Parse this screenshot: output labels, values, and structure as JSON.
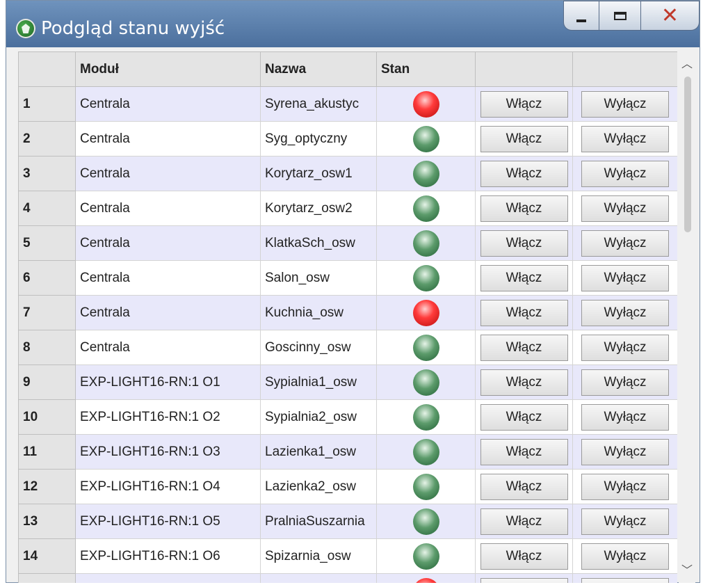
{
  "window": {
    "title": "Podgląd stanu wyjść",
    "colors": {
      "titlebar": "#5a7fae",
      "led_on": "#ff3b3b",
      "led_off": "#3f8452",
      "row_alt": "#e8e8fa"
    }
  },
  "table": {
    "columns": [
      "",
      "Moduł",
      "Nazwa",
      "Stan",
      "",
      ""
    ],
    "on_label": "Włącz",
    "off_label": "Wyłącz",
    "rows": [
      {
        "num": "1",
        "module": "Centrala",
        "name": "Syrena_akustyc",
        "state": "on"
      },
      {
        "num": "2",
        "module": "Centrala",
        "name": "Syg_optyczny",
        "state": "off"
      },
      {
        "num": "3",
        "module": "Centrala",
        "name": "Korytarz_osw1",
        "state": "off"
      },
      {
        "num": "4",
        "module": "Centrala",
        "name": "Korytarz_osw2",
        "state": "off"
      },
      {
        "num": "5",
        "module": "Centrala",
        "name": "KlatkaSch_osw",
        "state": "off"
      },
      {
        "num": "6",
        "module": "Centrala",
        "name": "Salon_osw",
        "state": "off"
      },
      {
        "num": "7",
        "module": "Centrala",
        "name": "Kuchnia_osw",
        "state": "on"
      },
      {
        "num": "8",
        "module": "Centrala",
        "name": "Goscinny_osw",
        "state": "off"
      },
      {
        "num": "9",
        "module": "EXP-LIGHT16-RN:1 O1",
        "name": "Sypialnia1_osw",
        "state": "off"
      },
      {
        "num": "10",
        "module": "EXP-LIGHT16-RN:1 O2",
        "name": "Sypialnia2_osw",
        "state": "off"
      },
      {
        "num": "11",
        "module": "EXP-LIGHT16-RN:1 O3",
        "name": "Lazienka1_osw",
        "state": "off"
      },
      {
        "num": "12",
        "module": "EXP-LIGHT16-RN:1 O4",
        "name": "Lazienka2_osw",
        "state": "off"
      },
      {
        "num": "13",
        "module": "EXP-LIGHT16-RN:1 O5",
        "name": "PralniaSuszarnia",
        "state": "off"
      },
      {
        "num": "14",
        "module": "EXP-LIGHT16-RN:1 O6",
        "name": "Spizarnia_osw",
        "state": "off"
      },
      {
        "num": "",
        "module": "",
        "name": "",
        "state": "on"
      }
    ]
  },
  "scrollbar": {
    "up_icon": "chevron-up-icon",
    "down_icon": "chevron-down-icon"
  }
}
